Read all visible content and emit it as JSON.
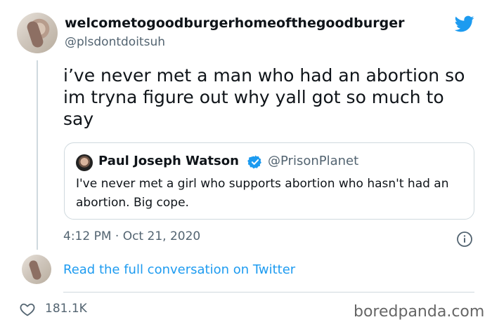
{
  "author": {
    "display_name": "welcometogoodburgerhomeofthegoodburger",
    "handle": "@plsdontdoitsuh"
  },
  "tweet": {
    "text": "i’ve never met a man who had an abortion so im tryna figure out why yall got so much to say",
    "timestamp": "4:12 PM · Oct 21, 2020"
  },
  "quoted_tweet": {
    "display_name": "Paul Joseph Watson",
    "handle": "@PrisonPlanet",
    "text": "I've never met a girl who supports abortion who hasn't had an abortion. Big cope."
  },
  "actions": {
    "read_full_conversation": "Read the full conversation on Twitter",
    "likes_count": "181.1K"
  },
  "watermark": "boredpanda.com",
  "colors": {
    "brand_blue": "#1d9bf0",
    "secondary_text": "#536471",
    "border": "#cfd9de"
  },
  "icons": {
    "brand": "twitter-bird-icon",
    "verified": "verified-badge-icon",
    "info": "info-icon",
    "like": "heart-icon"
  }
}
